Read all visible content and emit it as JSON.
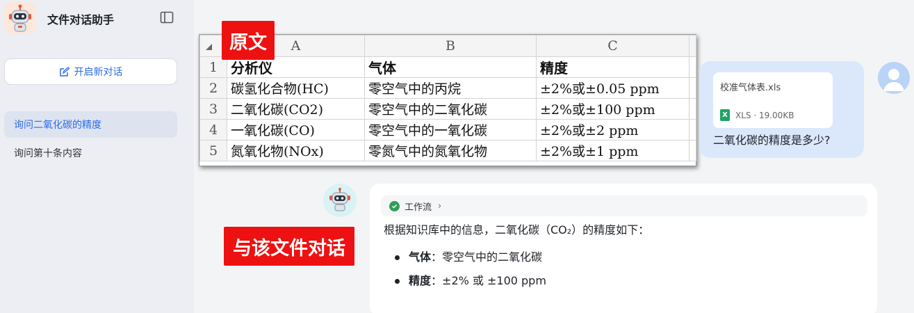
{
  "sidebar": {
    "app_title": "文件对话助手",
    "new_chat_label": "开启新对话",
    "conversations": [
      {
        "label": "询问二氧化碳的精度",
        "active": true
      },
      {
        "label": "询问第十条内容",
        "active": false
      }
    ]
  },
  "overlay_labels": {
    "original": "原文",
    "chat_with_file": "与该文件对话"
  },
  "spreadsheet": {
    "columns": [
      "A",
      "B",
      "C"
    ],
    "row_numbers": [
      "1",
      "2",
      "3",
      "4",
      "5"
    ],
    "rows": [
      [
        "分析仪",
        "气体",
        "精度"
      ],
      [
        "碳氢化合物(HC)",
        "零空气中的丙烷",
        "±2%或±0.05 ppm"
      ],
      [
        "二氧化碳(CO2)",
        "零空气中的二氧化碳",
        "±2%或±100 ppm"
      ],
      [
        "一氧化碳(CO)",
        "零空气中的一氧化碳",
        "±2%或±2 ppm"
      ],
      [
        "氮氧化物(NOx)",
        "零氮气中的氮氧化物",
        "±2%或±1 ppm"
      ]
    ]
  },
  "user_message": {
    "file_name": "校准气体表.xls",
    "file_meta": "XLS · 19.00KB",
    "file_icon_letter": "X",
    "question": "二氧化碳的精度是多少?"
  },
  "assistant_message": {
    "workflow_label": "工作流",
    "intro": "根据知识库中的信息，二氧化碳（CO₂）的精度如下：",
    "bullets": [
      {
        "key": "气体",
        "sep": "：",
        "value": "零空气中的二氧化碳"
      },
      {
        "key": "精度",
        "sep": "：",
        "value": "±2% 或 ±100 ppm"
      }
    ]
  },
  "colors": {
    "accent": "#2b6be6",
    "label_red": "#ee1111",
    "user_bubble": "#dbe7fb",
    "success_green": "#2f9e5b"
  }
}
